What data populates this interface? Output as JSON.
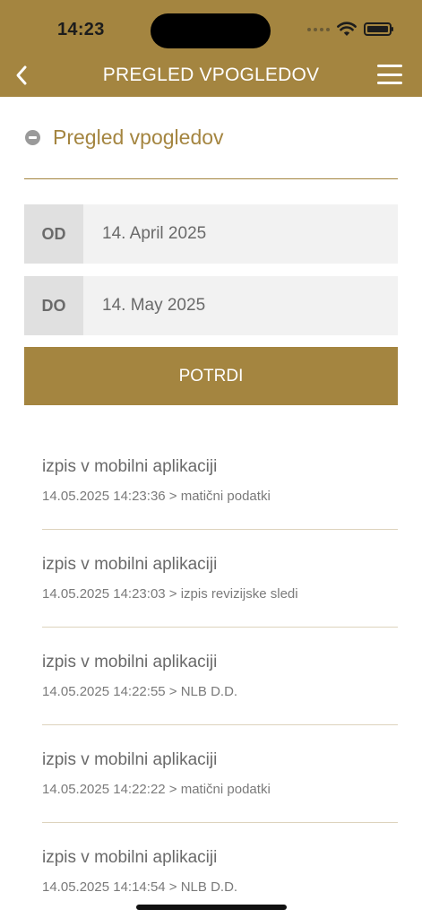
{
  "status_bar": {
    "time": "14:23"
  },
  "nav": {
    "title": "PREGLED VPOGLEDOV"
  },
  "section": {
    "title": "Pregled vpogledov"
  },
  "filters": {
    "from_label": "OD",
    "from_value": "14. April 2025",
    "to_label": "DO",
    "to_value": "14. May 2025",
    "confirm_label": "POTRDI"
  },
  "items": [
    {
      "title": "izpis v mobilni aplikaciji",
      "detail": "14.05.2025 14:23:36 > matični podatki"
    },
    {
      "title": "izpis v mobilni aplikaciji",
      "detail": "14.05.2025 14:23:03 > izpis revizijske sledi"
    },
    {
      "title": "izpis v mobilni aplikaciji",
      "detail": "14.05.2025 14:22:55 > NLB D.D."
    },
    {
      "title": "izpis v mobilni aplikaciji",
      "detail": "14.05.2025 14:22:22 > matični podatki"
    },
    {
      "title": "izpis v mobilni aplikaciji",
      "detail": "14.05.2025 14:14:54 > NLB D.D."
    }
  ],
  "colors": {
    "brand": "#a48540",
    "label_bg": "#e0e0e0",
    "field_bg": "#f2f2f2"
  },
  "icons": [
    "back-chevron-icon",
    "hamburger-menu-icon",
    "collapse-minus-icon",
    "wifi-icon",
    "battery-icon"
  ]
}
